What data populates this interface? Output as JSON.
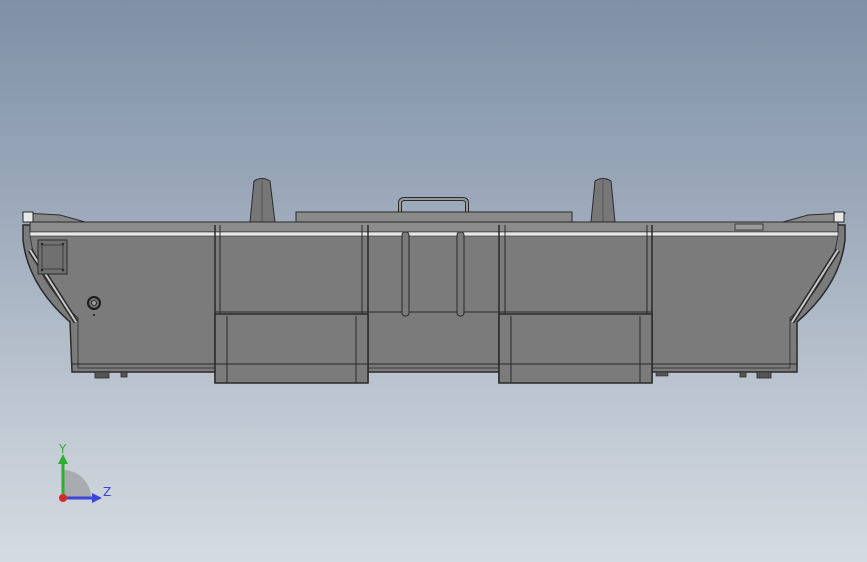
{
  "viewport": {
    "background_top": "#7f90a7",
    "background_bottom": "#d5dbe2"
  },
  "model": {
    "part_fill": "#7b7b7b",
    "edge_color": "#2a2a2a",
    "highlight_color": "#e8e8e8"
  },
  "triad": {
    "y_label": "Y",
    "z_label": "Z",
    "y_color": "#2fae2f",
    "z_color": "#3b45d6",
    "x_color": "#d42a2a"
  }
}
